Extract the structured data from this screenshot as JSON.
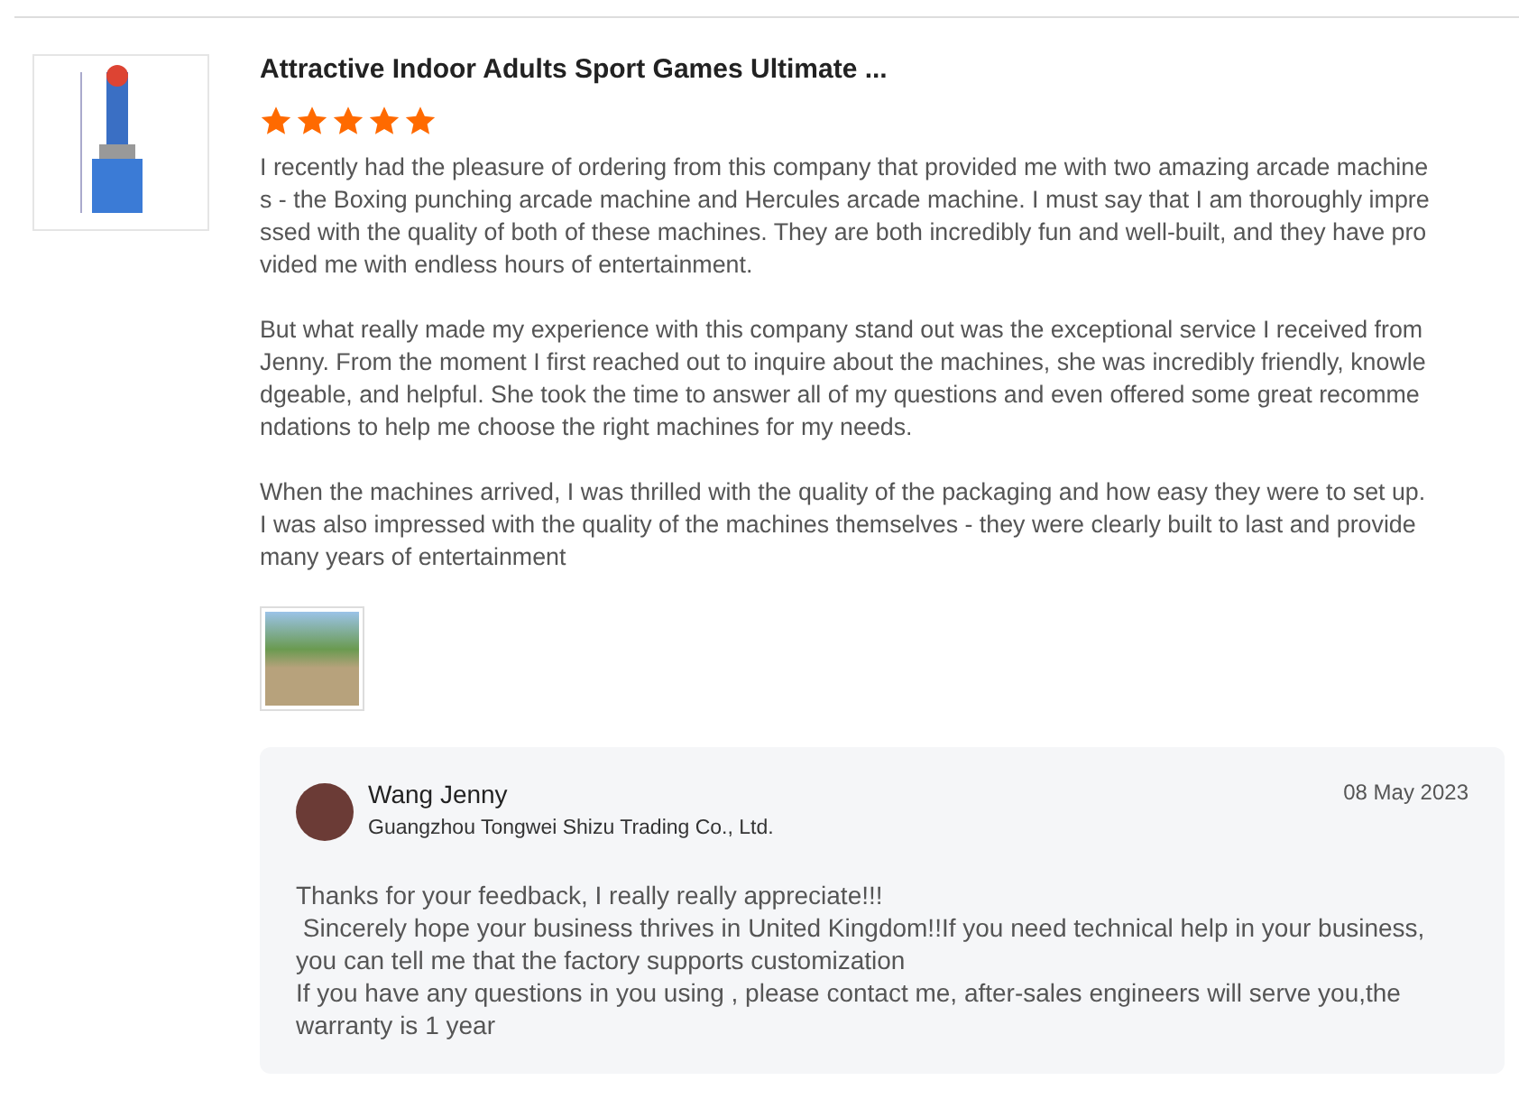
{
  "review": {
    "product_title": "Attractive Indoor Adults Sport Games Ultimate ...",
    "stars": 5,
    "paragraphs": [
      "I recently had the pleasure of ordering from this company that provided me with two amazing arcade machines - the Boxing punching arcade machine and Hercules arcade machine. I must say that I am thoroughly impressed with the quality of both of these machines. They are both incredibly fun and well-built, and they have provided me with endless hours of entertainment.",
      "But what really made my experience with this company stand out was the exceptional service I received from Jenny. From the moment I first reached out to inquire about the machines, she was incredibly friendly, knowledgeable, and helpful. She took the time to answer all of my questions and even offered some great recommendations to help me choose the right machines for my needs.",
      "When the machines arrived, I was thrilled with the quality of the packaging and how easy they were to set up. I was also impressed with the quality of the machines themselves - they were clearly built to last and provide many years of entertainment"
    ]
  },
  "reply": {
    "name": "Wang Jenny",
    "company": "Guangzhou Tongwei Shizu Trading Co., Ltd.",
    "date": "08 May 2023",
    "lines": [
      "Thanks for your feedback, I really really appreciate!!!",
      " Sincerely hope your business thrives in United Kingdom!!If you need technical help in your business, you can tell me that the factory supports customization",
      "If you have any questions in you using , please contact me, after-sales engineers will serve you,the warranty is 1 year"
    ]
  }
}
